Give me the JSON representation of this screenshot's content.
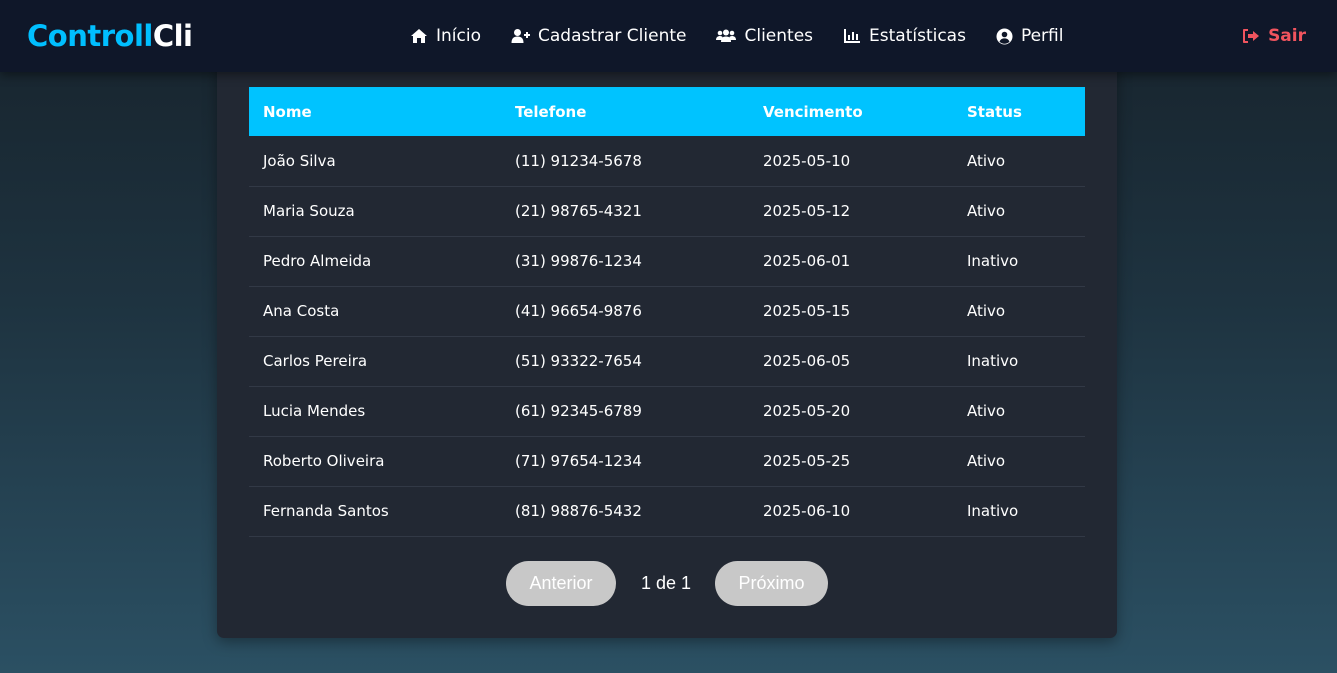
{
  "brand": {
    "part1": "Controll",
    "part2": "Cli"
  },
  "nav": {
    "items": [
      {
        "label": "Início",
        "icon": "home-icon"
      },
      {
        "label": "Cadastrar Cliente",
        "icon": "user-plus-icon"
      },
      {
        "label": "Clientes",
        "icon": "users-icon"
      },
      {
        "label": "Estatísticas",
        "icon": "bar-chart-icon"
      },
      {
        "label": "Perfil",
        "icon": "user-circle-icon"
      }
    ],
    "logout": {
      "label": "Sair",
      "icon": "sign-out-icon"
    }
  },
  "table": {
    "headers": [
      "Nome",
      "Telefone",
      "Vencimento",
      "Status"
    ],
    "rows": [
      [
        "João Silva",
        "(11) 91234-5678",
        "2025-05-10",
        "Ativo"
      ],
      [
        "Maria Souza",
        "(21) 98765-4321",
        "2025-05-12",
        "Ativo"
      ],
      [
        "Pedro Almeida",
        "(31) 99876-1234",
        "2025-06-01",
        "Inativo"
      ],
      [
        "Ana Costa",
        "(41) 96654-9876",
        "2025-05-15",
        "Ativo"
      ],
      [
        "Carlos Pereira",
        "(51) 93322-7654",
        "2025-06-05",
        "Inativo"
      ],
      [
        "Lucia Mendes",
        "(61) 92345-6789",
        "2025-05-20",
        "Ativo"
      ],
      [
        "Roberto Oliveira",
        "(71) 97654-1234",
        "2025-05-25",
        "Ativo"
      ],
      [
        "Fernanda Santos",
        "(81) 98876-5432",
        "2025-06-10",
        "Inativo"
      ]
    ]
  },
  "pagination": {
    "prev_label": "Anterior",
    "info": "1 de 1",
    "next_label": "Próximo"
  },
  "colors": {
    "accent": "#00c3ff",
    "brand": "#00bfff",
    "logout": "#f0545e",
    "navbar": "#0f1729",
    "card": "#222833",
    "pager_button": "#c8c8c8"
  }
}
